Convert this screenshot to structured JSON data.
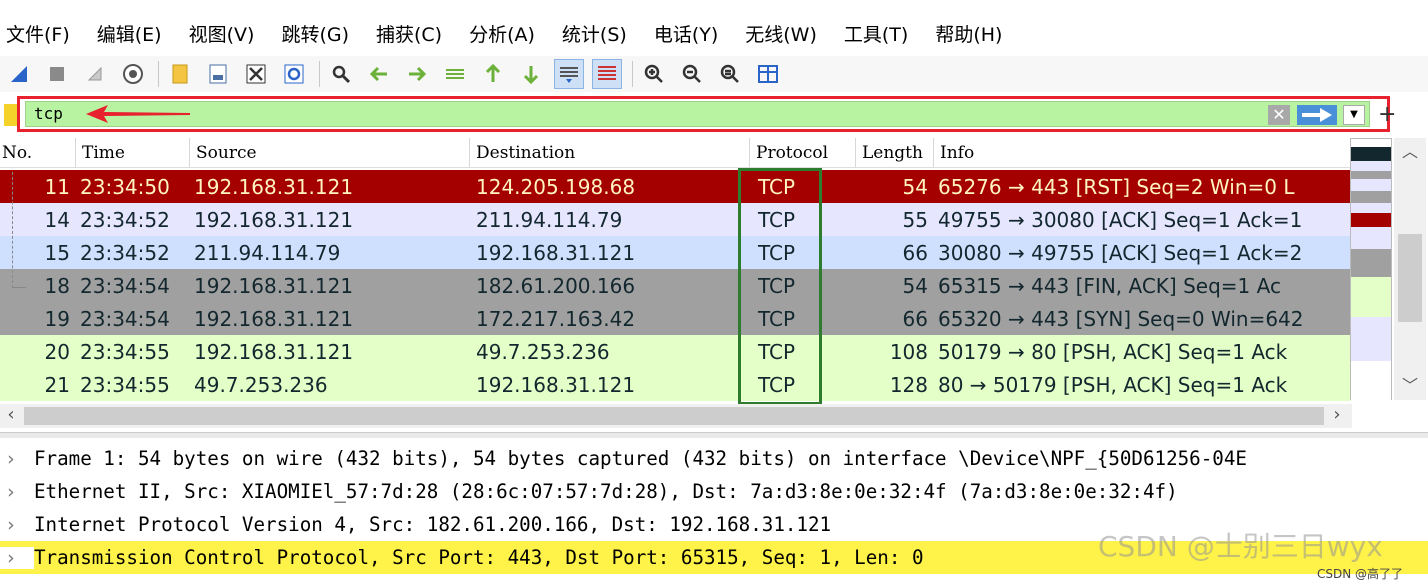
{
  "menu": [
    "文件(F)",
    "编辑(E)",
    "视图(V)",
    "跳转(G)",
    "捕获(C)",
    "分析(A)",
    "统计(S)",
    "电话(Y)",
    "无线(W)",
    "工具(T)",
    "帮助(H)"
  ],
  "toolbar_icons": [
    "start-capture-icon",
    "stop-capture-icon",
    "restart-capture-icon",
    "capture-options-icon",
    "open-file-icon",
    "save-file-icon",
    "close-file-icon",
    "reload-file-icon",
    "find-packet-icon",
    "go-back-icon",
    "go-forward-icon",
    "go-to-packet-icon",
    "first-packet-icon",
    "last-packet-icon",
    "autoscroll-icon",
    "colorize-icon",
    "zoom-in-icon",
    "zoom-out-icon",
    "normal-size-icon",
    "resize-columns-icon"
  ],
  "filter": {
    "value": "tcp"
  },
  "packet_list": {
    "columns": [
      "No.",
      "Time",
      "Source",
      "Destination",
      "Protocol",
      "Length",
      "Info"
    ],
    "rows": [
      {
        "no": "11",
        "time": "23:34:50",
        "source": "192.168.31.121",
        "destination": "124.205.198.68",
        "protocol": "TCP",
        "length": "54",
        "info": "65276 → 443 [RST] Seq=2 Win=0 L",
        "bg": "#a40000",
        "fg": "#fff4c2"
      },
      {
        "no": "14",
        "time": "23:34:52",
        "source": "192.168.31.121",
        "destination": "211.94.114.79",
        "protocol": "TCP",
        "length": "55",
        "info": "49755 → 30080 [ACK] Seq=1 Ack=1",
        "bg": "#e7e6ff",
        "fg": "#12272e"
      },
      {
        "no": "15",
        "time": "23:34:52",
        "source": "211.94.114.79",
        "destination": "192.168.31.121",
        "protocol": "TCP",
        "length": "66",
        "info": "30080 → 49755 [ACK] Seq=1 Ack=2",
        "bg": "#cfe0ff",
        "fg": "#12272e"
      },
      {
        "no": "18",
        "time": "23:34:54",
        "source": "192.168.31.121",
        "destination": "182.61.200.166",
        "protocol": "TCP",
        "length": "54",
        "info": "65315 → 443 [FIN, ACK] Seq=1 Ac",
        "bg": "#a0a0a0",
        "fg": "#12272e"
      },
      {
        "no": "19",
        "time": "23:34:54",
        "source": "192.168.31.121",
        "destination": "172.217.163.42",
        "protocol": "TCP",
        "length": "66",
        "info": "65320 → 443 [SYN] Seq=0 Win=642",
        "bg": "#a0a0a0",
        "fg": "#12272e"
      },
      {
        "no": "20",
        "time": "23:34:55",
        "source": "192.168.31.121",
        "destination": "49.7.253.236",
        "protocol": "TCP",
        "length": "108",
        "info": "50179 → 80 [PSH, ACK] Seq=1 Ack",
        "bg": "#e4ffc7",
        "fg": "#12272e"
      },
      {
        "no": "21",
        "time": "23:34:55",
        "source": "49.7.253.236",
        "destination": "192.168.31.121",
        "protocol": "TCP",
        "length": "128",
        "info": "80 → 50179 [PSH, ACK] Seq=1 Ack",
        "bg": "#e4ffc7",
        "fg": "#12272e"
      }
    ]
  },
  "minimap_colors": [
    "#ffffff",
    "#12272e",
    "#e7e6ff",
    "#a0a0a0",
    "#e7e6ff",
    "#a0a0a0",
    "#e7e6ff",
    "#a40000",
    "#e7e6ff",
    "#a0a0a0",
    "#e4ffc7",
    "#e7e6ff",
    "#ffffff"
  ],
  "details": [
    {
      "text": "Frame 1: 54 bytes on wire (432 bits), 54 bytes captured (432 bits) on interface \\Device\\NPF_{50D61256-04E",
      "selected": false
    },
    {
      "text": "Ethernet II, Src: XIAOMIEl_57:7d:28 (28:6c:07:57:7d:28), Dst: 7a:d3:8e:0e:32:4f (7a:d3:8e:0e:32:4f)",
      "selected": false
    },
    {
      "text": "Internet Protocol Version 4, Src: 182.61.200.166, Dst: 192.168.31.121",
      "selected": false
    },
    {
      "text": "Transmission Control Protocol, Src Port: 443, Dst Port: 65315, Seq: 1, Len: 0",
      "selected": true
    }
  ],
  "watermark": "CSDN @士别三日wyx",
  "credit": "CSDN @高了了",
  "colors": {
    "annotation_red": "#e8212f",
    "annotation_green": "#2e7d2e",
    "filter_valid": "#b7f3a0",
    "detail_selected": "#fff248"
  }
}
